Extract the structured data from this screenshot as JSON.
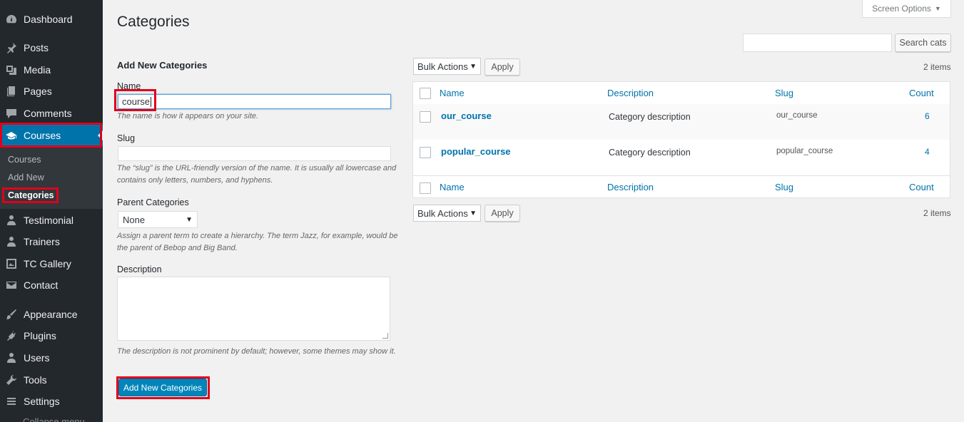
{
  "sidebar": {
    "items": [
      {
        "id": "dashboard",
        "label": "Dashboard",
        "icon": "dashboard-icon"
      },
      {
        "id": "posts",
        "label": "Posts",
        "icon": "pin-icon"
      },
      {
        "id": "media",
        "label": "Media",
        "icon": "media-icon"
      },
      {
        "id": "pages",
        "label": "Pages",
        "icon": "pages-icon"
      },
      {
        "id": "comments",
        "label": "Comments",
        "icon": "comment-icon"
      },
      {
        "id": "courses",
        "label": "Courses",
        "icon": "graduation-cap-icon"
      },
      {
        "id": "testimonial",
        "label": "Testimonial",
        "icon": "person-icon"
      },
      {
        "id": "trainers",
        "label": "Trainers",
        "icon": "person-icon"
      },
      {
        "id": "tc-gallery",
        "label": "TC Gallery",
        "icon": "gallery-icon"
      },
      {
        "id": "contact",
        "label": "Contact",
        "icon": "envelope-icon"
      },
      {
        "id": "appearance",
        "label": "Appearance",
        "icon": "brush-icon"
      },
      {
        "id": "plugins",
        "label": "Plugins",
        "icon": "plug-icon"
      },
      {
        "id": "users",
        "label": "Users",
        "icon": "users-icon"
      },
      {
        "id": "tools",
        "label": "Tools",
        "icon": "wrench-icon"
      },
      {
        "id": "settings",
        "label": "Settings",
        "icon": "settings-icon"
      }
    ],
    "submenu": [
      "Courses",
      "Add New",
      "Categories"
    ],
    "collapse_label": "Collapse menu"
  },
  "header": {
    "title": "Categories",
    "screen_options": "Screen Options",
    "search_button": "Search cats",
    "search_value": ""
  },
  "form": {
    "heading": "Add New Categories",
    "name_label": "Name",
    "name_value": "course",
    "name_help": "The name is how it appears on your site.",
    "slug_label": "Slug",
    "slug_value": "",
    "slug_help": "The “slug” is the URL-friendly version of the name. It is usually all lowercase and contains only letters, numbers, and hyphens.",
    "parent_label": "Parent Categories",
    "parent_value": "None",
    "parent_help": "Assign a parent term to create a hierarchy. The term Jazz, for example, would be the parent of Bebop and Big Band.",
    "description_label": "Description",
    "description_help": "The description is not prominent by default; however, some themes may show it.",
    "submit_label": "Add New Categories"
  },
  "table": {
    "bulk_actions": "Bulk Actions",
    "apply": "Apply",
    "items_count": "2 items",
    "columns": [
      "Name",
      "Description",
      "Slug",
      "Count"
    ],
    "rows": [
      {
        "name": "our_course",
        "description": "Category description",
        "slug": "our_course",
        "count": "6"
      },
      {
        "name": "popular_course",
        "description": "Category description",
        "slug": "popular_course",
        "count": "4"
      }
    ]
  },
  "colors": {
    "sidebar_bg": "#23282d",
    "active_menu": "#0073aa",
    "primary_button": "#0085ba",
    "highlight": "#e0001b"
  }
}
